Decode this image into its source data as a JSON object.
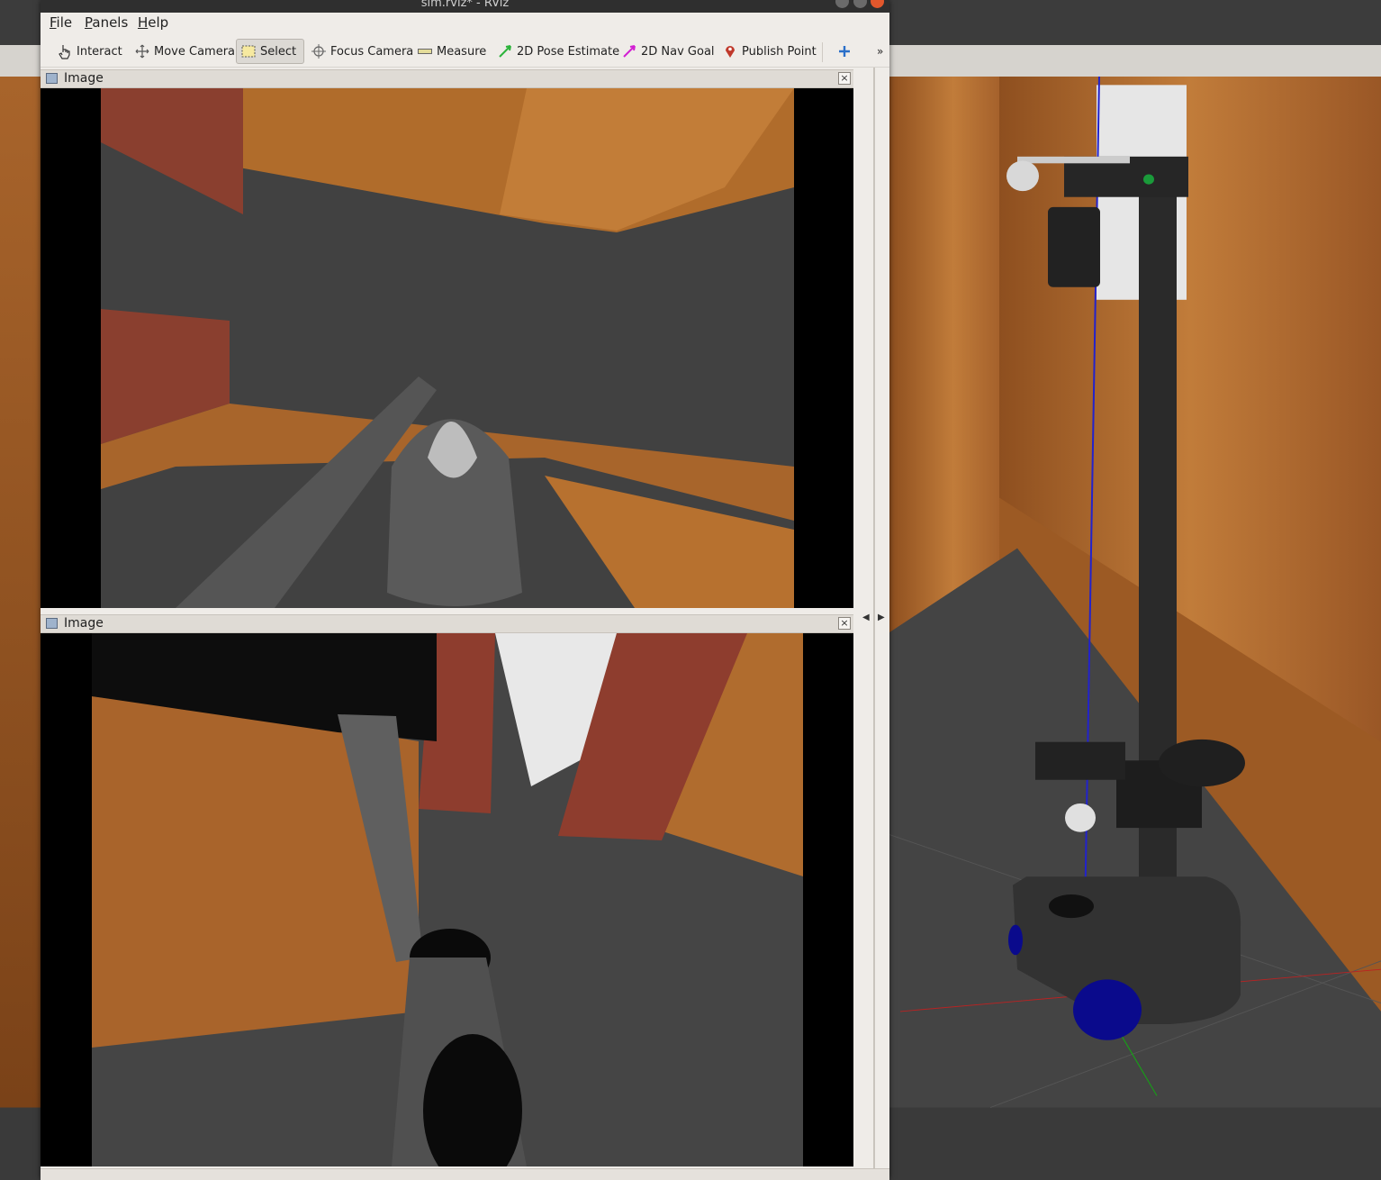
{
  "window": {
    "title": "sim.rviz* - RViz"
  },
  "menubar": {
    "items": [
      {
        "label": "File",
        "mnemonic": "F",
        "rest": "ile"
      },
      {
        "label": "Panels",
        "mnemonic": "P",
        "rest": "anels"
      },
      {
        "label": "Help",
        "mnemonic": "H",
        "rest": "elp"
      }
    ]
  },
  "toolbar": {
    "tools": [
      {
        "label": "Interact",
        "icon": "hand-pointer-icon",
        "active": false
      },
      {
        "label": "Move Camera",
        "icon": "move-camera-icon",
        "active": false
      },
      {
        "label": "Select",
        "icon": "select-box-icon",
        "active": true
      },
      {
        "label": "Focus Camera",
        "icon": "crosshair-icon",
        "active": false
      },
      {
        "label": "Measure",
        "icon": "ruler-icon",
        "active": false
      },
      {
        "label": "2D Pose Estimate",
        "icon": "green-arrow-icon",
        "active": false
      },
      {
        "label": "2D Nav Goal",
        "icon": "magenta-arrow-icon",
        "active": false
      },
      {
        "label": "Publish Point",
        "icon": "map-pin-icon",
        "active": false
      }
    ],
    "add_tool_icon": "plus-icon",
    "overflow_icon": "double-chevron-right-icon"
  },
  "panels": [
    {
      "title": "Image",
      "close": "×"
    },
    {
      "title": "Image",
      "close": "×"
    }
  ],
  "colors": {
    "window_bg": "#efece8",
    "wood": "#b8732f",
    "floor": "#3f3f3f",
    "brick": "#9a3a2a",
    "robot_dark": "#262626",
    "wheel_blue": "#0a0a8c"
  }
}
